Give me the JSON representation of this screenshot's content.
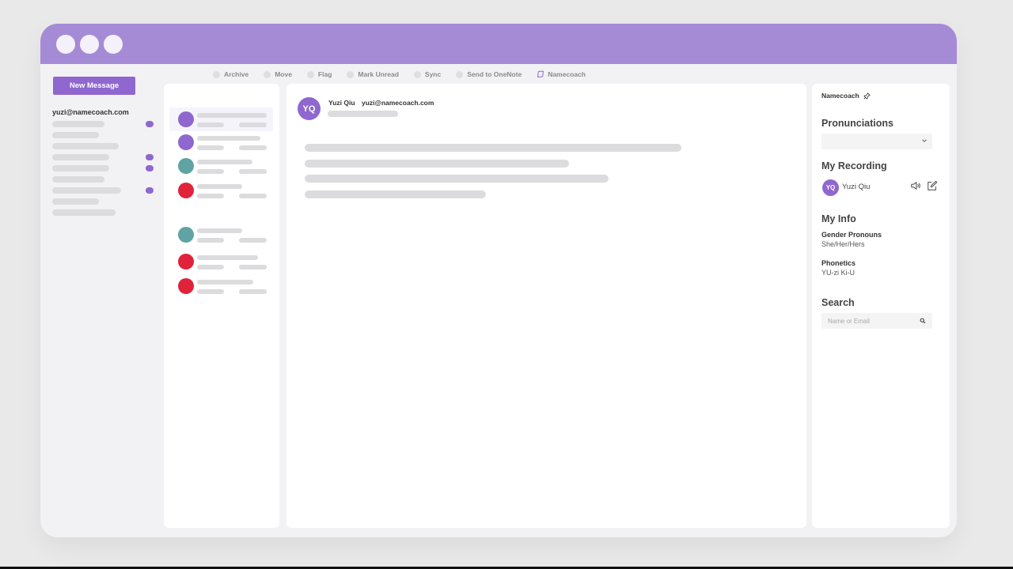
{
  "window": {
    "controls": [
      "close",
      "minimize",
      "maximize"
    ]
  },
  "sidebar": {
    "new_message_label": "New Message",
    "account_email": "yuzi@namecoach.com",
    "folders_loading": 10
  },
  "toolbar": {
    "items": [
      {
        "label": "Archive"
      },
      {
        "label": "Move"
      },
      {
        "label": "Flag"
      },
      {
        "label": "Mark Unread"
      },
      {
        "label": "Sync"
      },
      {
        "label": "Send to OneNote"
      },
      {
        "label": "Namecoach"
      }
    ]
  },
  "message_list": {
    "avatar_colors": [
      "#8f67cf",
      "#8f67cf",
      "#5fa3a3",
      "#e0233a",
      "#5fa3a3",
      "#e0233a",
      "#e0233a"
    ]
  },
  "reading_pane": {
    "avatar_initials": "YQ",
    "sender_name": "Yuzi Qiu",
    "sender_email": "yuzi@namecoach.com"
  },
  "namecoach": {
    "title": "Namecoach",
    "pronunciations_heading": "Pronunciations",
    "recording_heading": "My Recording",
    "recording_initials": "YQ",
    "recording_name": "Yuzi Qiu",
    "info_heading": "My Info",
    "pronouns_label": "Gender Pronouns",
    "pronouns_value": "She/Her/Hers",
    "phonetics_label": "Phonetics",
    "phonetics_value": "YU-zi Ki-U",
    "search_heading": "Search",
    "search_placeholder": "Name or Email"
  },
  "colors": {
    "accent": "#8f67cf",
    "titlebar": "#a58bd6",
    "teal": "#5fa3a3",
    "red": "#e0233a"
  }
}
